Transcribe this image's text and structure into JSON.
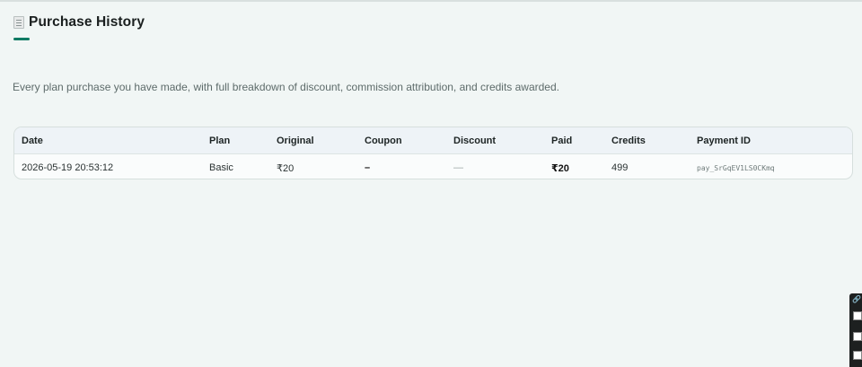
{
  "header": {
    "icon": "document-icon",
    "title": "Purchase History"
  },
  "subtitle": "Every plan purchase you have made, with full breakdown of discount, commission attribution, and credits awarded.",
  "table": {
    "columns": [
      "Date",
      "Plan",
      "Original",
      "Coupon",
      "Discount",
      "Paid",
      "Credits",
      "Payment ID"
    ],
    "rows": [
      {
        "date": "2026-05-19 20:53:12",
        "plan": "Basic",
        "original": "₹20",
        "coupon": "–",
        "discount": "—",
        "paid": "₹20",
        "credits": "499",
        "payment_id": "pay_SrGqEV1LS0CKmq"
      }
    ]
  },
  "colors": {
    "accent": "#0f7a63",
    "background": "#f1f6f5"
  },
  "side_widget": {
    "icon": "link-icon"
  }
}
